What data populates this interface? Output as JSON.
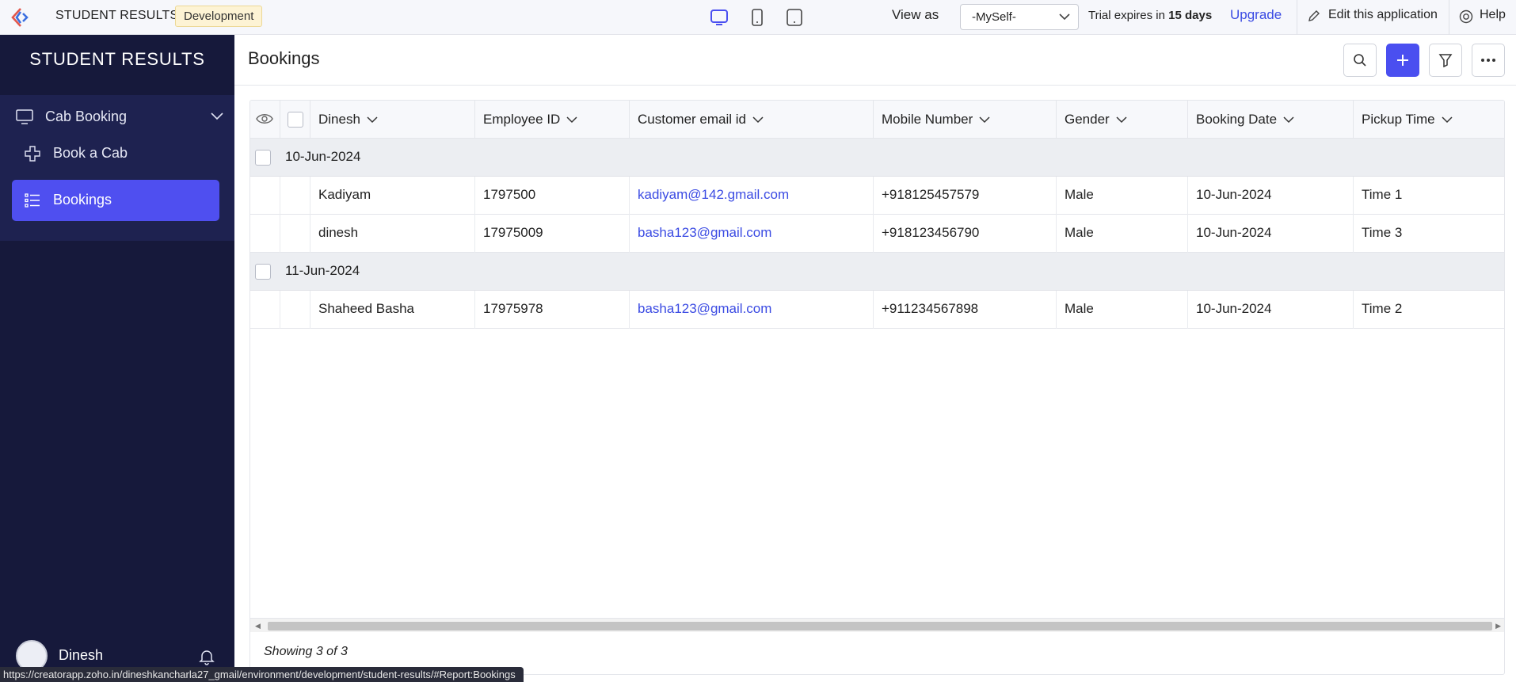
{
  "topbar": {
    "app_name": "STUDENT RESULTS",
    "environment": "Development",
    "view_as_label": "View as",
    "view_as_value": "-MySelf-",
    "trial_prefix": "Trial expires in",
    "trial_days": "15 days",
    "upgrade": "Upgrade",
    "edit_app": "Edit this application",
    "help": "Help",
    "accent": "#4a4ff0"
  },
  "sidebar": {
    "title": "STUDENT RESULTS",
    "group": {
      "label": "Cab Booking",
      "icon": "monitor-icon"
    },
    "items": [
      {
        "label": "Book a Cab",
        "icon": "plus-cross-icon",
        "active": false
      },
      {
        "label": "Bookings",
        "icon": "list-icon",
        "active": true
      }
    ],
    "user_name": "Dinesh"
  },
  "page": {
    "title": "Bookings"
  },
  "table": {
    "columns": [
      "Dinesh",
      "Employee ID",
      "Customer email id",
      "Mobile Number",
      "Gender",
      "Booking Date",
      "Pickup Time"
    ],
    "groups": [
      {
        "label": "10-Jun-2024",
        "rows": [
          [
            "Kadiyam",
            "1797500",
            "kadiyam@142.gmail.com",
            "+918125457579",
            "Male",
            "10-Jun-2024",
            "Time 1"
          ],
          [
            "dinesh",
            "17975009",
            "basha123@gmail.com",
            "+918123456790",
            "Male",
            "10-Jun-2024",
            "Time 3"
          ]
        ]
      },
      {
        "label": "11-Jun-2024",
        "rows": [
          [
            "Shaheed Basha",
            "17975978",
            "basha123@gmail.com",
            "+911234567898",
            "Male",
            "10-Jun-2024",
            "Time 2"
          ]
        ]
      }
    ],
    "footer": "Showing 3 of 3"
  },
  "status_url": "https://creatorapp.zoho.in/dineshkancharla27_gmail/environment/development/student-results/#Report:Bookings"
}
